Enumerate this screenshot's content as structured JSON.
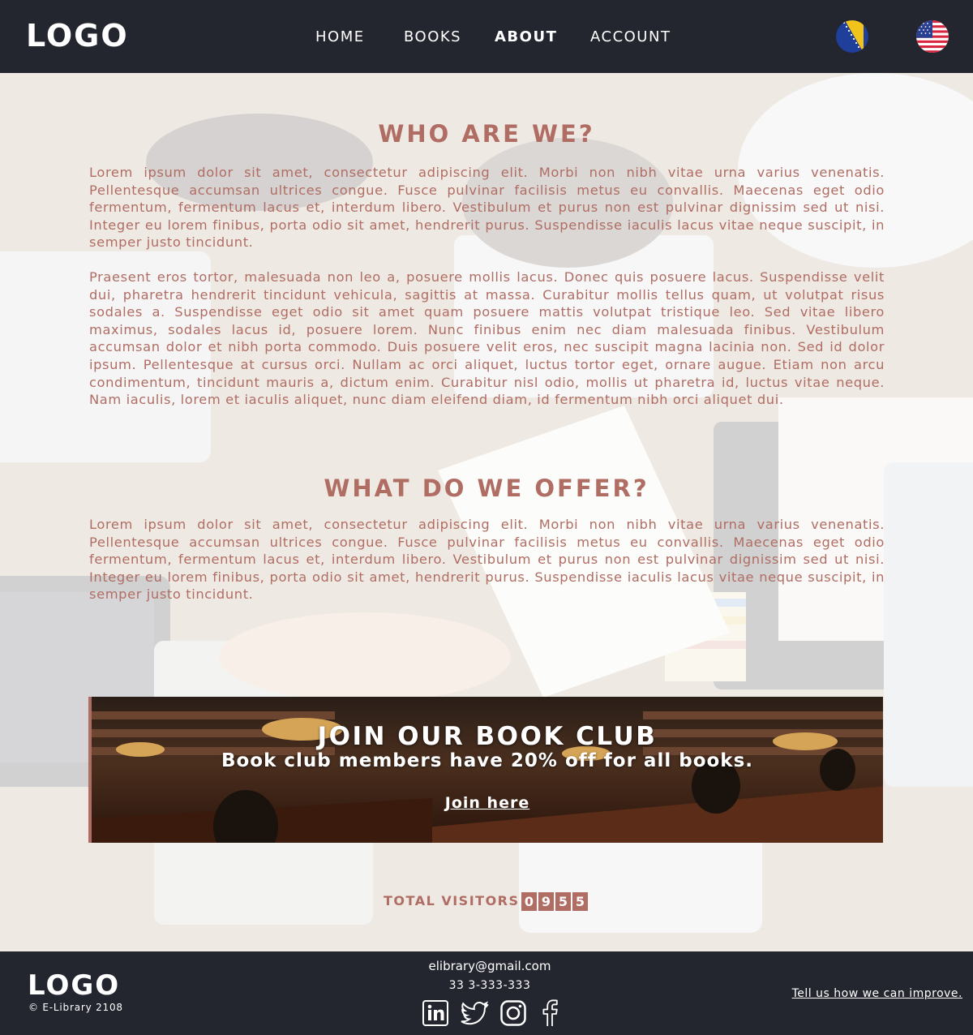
{
  "header": {
    "logo": "LOGO",
    "nav": [
      "HOME",
      "BOOKS",
      "ABOUT",
      "ACCOUNT"
    ],
    "active_nav": "ABOUT",
    "languages": [
      "bosnia-flag-icon",
      "usa-flag-icon"
    ]
  },
  "about": {
    "title": "WHO ARE WE?",
    "paragraph1": "Lorem ipsum dolor sit amet, consectetur adipiscing elit. Morbi non nibh vitae urna varius venenatis. Pellentesque accumsan ultrices congue. Fusce pulvinar facilisis metus eu convallis. Maecenas eget odio fermentum, fermentum lacus et, interdum libero. Vestibulum et purus non est pulvinar dignissim sed ut nisi. Integer eu lorem finibus, porta odio sit amet, hendrerit purus. Suspendisse iaculis lacus vitae neque suscipit, in semper justo tincidunt.",
    "paragraph2": "Praesent eros tortor, malesuada non leo a, posuere mollis lacus. Donec quis posuere lacus. Suspendis­se velit dui, pharetra hendrerit tincidunt vehicula, sagittis at massa. Curabitur mollis tellus quam, ut volutpat risus sodales a. Suspendisse eget odio sit amet quam posuere mattis volutpat tristique leo. Sed vitae libero maximus, sodales lacus id, posuere lorem. Nunc finibus enim nec diam malesuada fin­ibus. Vestibulum accumsan dolor et nibh porta commodo. Duis posuere velit eros, nec suscipit magna lacinia non. Sed id dolor ipsum. Pellentesque at cursus orci. Nullam ac orci aliquet, luctus tortor eget, ornare augue. Etiam non arcu condimentum, tincidunt mauris a, dictum enim. Curabitur nisl odio, mollis ut pharetra id, luctus vitae neque. Nam iaculis, lorem et iaculis aliquet, nunc diam eleifend diam, id fermentum nibh orci aliquet dui."
  },
  "offer": {
    "title": "WHAT DO WE OFFER?",
    "paragraph": "Lorem ipsum dolor sit amet, consectetur adipiscing elit. Morbi non nibh vitae urna varius venenatis. Pellentesque accumsan ultrices congue. Fusce pulvinar facilisis metus eu convallis. Maecenas eget odio fermentum, fermentum lacus et, interdum libero. Vestibulum et purus non est pulvinar dignissim sed ut nisi. Integer eu lorem finibus, porta odio sit amet, hendrerit purus. Suspendisse iaculis lacus vitae neque suscipit, in semper justo tincidunt."
  },
  "book_club": {
    "title": "JOIN OUR BOOK CLUB",
    "subtitle": "Book club members have 20% off for all books.",
    "link": "Join here"
  },
  "visitors": {
    "label": "TOTAL VISITORS",
    "digits": [
      "0",
      "9",
      "5",
      "5"
    ]
  },
  "footer": {
    "logo": "LOGO",
    "copyright": "© E-Library 2108",
    "email": "elibrary@gmail.com",
    "phone": "33 3-333-333",
    "socials": [
      "linkedin-icon",
      "twitter-icon",
      "instagram-icon",
      "facebook-icon"
    ],
    "feedback_link": "Tell us how we can improve."
  },
  "colors": {
    "accent": "#b06d63",
    "header_bg": "#24262f",
    "text_light": "#ffffff"
  }
}
